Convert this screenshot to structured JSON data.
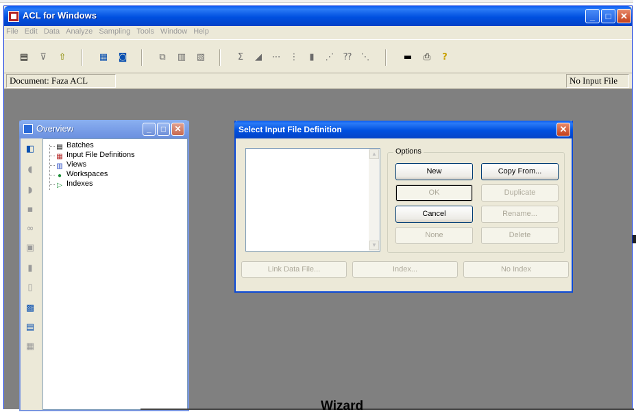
{
  "app": {
    "title": "ACL for Windows",
    "min_glyph": "_",
    "max_glyph": "□",
    "close_glyph": "✕"
  },
  "menu": [
    "File",
    "Edit",
    "Data",
    "Analyze",
    "Sampling",
    "Tools",
    "Window",
    "Help"
  ],
  "toolbar_glyphs": {
    "open": "▤",
    "filter": "⊽",
    "up": "⇧",
    "table": "▦",
    "report": "◙",
    "merge": "⧉",
    "extract": "▥",
    "profile": "▧",
    "total": "Σ",
    "stratify": "◢",
    "age": "⋯",
    "stats": "⋮",
    "classify": "▮",
    "sequence": "⋰",
    "gaps": "⁇",
    "dups": "⋱",
    "line": "▬",
    "print": "⎙",
    "help": "?"
  },
  "docbar": {
    "document_label": "Document: Faza ACL",
    "input_file_label": "No Input File"
  },
  "overview": {
    "title": "Overview",
    "tree": [
      {
        "label": "Batches",
        "icon": "▤",
        "color": "#000000"
      },
      {
        "label": "Input File Definitions",
        "icon": "▦",
        "color": "#b22222"
      },
      {
        "label": "Views",
        "icon": "▥",
        "color": "#1a3ec0"
      },
      {
        "label": "Workspaces",
        "icon": "●",
        "color": "#1f8f3a"
      },
      {
        "label": "Indexes",
        "icon": "▷",
        "color": "#1f8f3a"
      }
    ],
    "side_icons": [
      "◧",
      "◖",
      "◗",
      "▪",
      "∞",
      "▣",
      "▮",
      "▯",
      "▩",
      "▤",
      "▦"
    ]
  },
  "dialog": {
    "title": "Select Input File Definition",
    "options_legend": "Options",
    "buttons": {
      "new": "New",
      "copy_from": "Copy From...",
      "ok": "OK",
      "duplicate": "Duplicate",
      "cancel": "Cancel",
      "rename": "Rename...",
      "none": "None",
      "delete": "Delete",
      "link_data_file": "Link Data File...",
      "index": "Index...",
      "no_index": "No Index"
    }
  },
  "background": {
    "wizard_text": "Wizard"
  },
  "colors": {
    "xp_blue": "#0a5cf2",
    "workspace_gray": "#808080",
    "face": "#ece9d8"
  }
}
